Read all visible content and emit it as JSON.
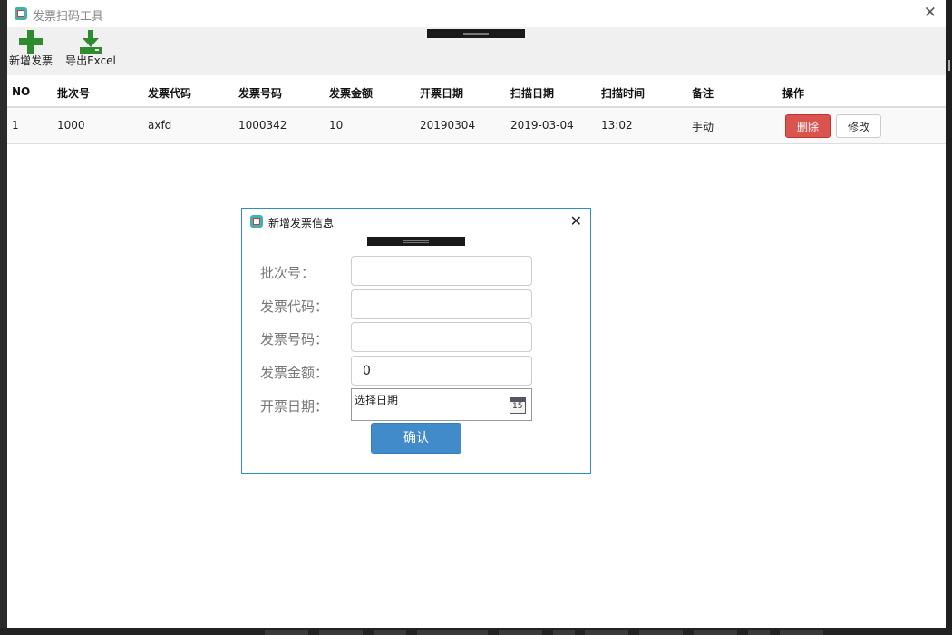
{
  "window": {
    "title": "发票扫码工具"
  },
  "toolbar": {
    "add_label": "新增发票",
    "export_label": "导出Excel"
  },
  "table": {
    "columns": [
      "NO",
      "批次号",
      "发票代码",
      "发票号码",
      "发票金额",
      "开票日期",
      "扫描日期",
      "扫描时间",
      "备注",
      "操作"
    ],
    "rows": [
      {
        "no": "1",
        "batch": "1000",
        "code": "axfd",
        "number": "1000342",
        "amount": "10",
        "invoice_date": "20190304",
        "scan_date": "2019-03-04",
        "scan_time": "13:02",
        "remark": "手动",
        "delete_label": "删除",
        "edit_label": "修改"
      }
    ]
  },
  "dialog": {
    "title": "新增发票信息",
    "labels": {
      "batch": "批次号：",
      "code": "发票代码：",
      "number": "发票号码：",
      "amount": "发票金额：",
      "date": "开票日期："
    },
    "values": {
      "batch": "",
      "code": "",
      "number": "",
      "amount": "0"
    },
    "date_placeholder": "选择日期",
    "calendar_day": "15",
    "confirm_label": "确认"
  },
  "colors": {
    "add_icon": "#2e8b2e",
    "delete_button": "#d9534f",
    "confirm_button": "#428bca",
    "dialog_border": "#2f8fbf"
  },
  "icons": {
    "app": "invoice-app-icon",
    "add": "plus-icon",
    "export": "download-icon",
    "close": "close-icon",
    "calendar": "calendar-icon"
  }
}
